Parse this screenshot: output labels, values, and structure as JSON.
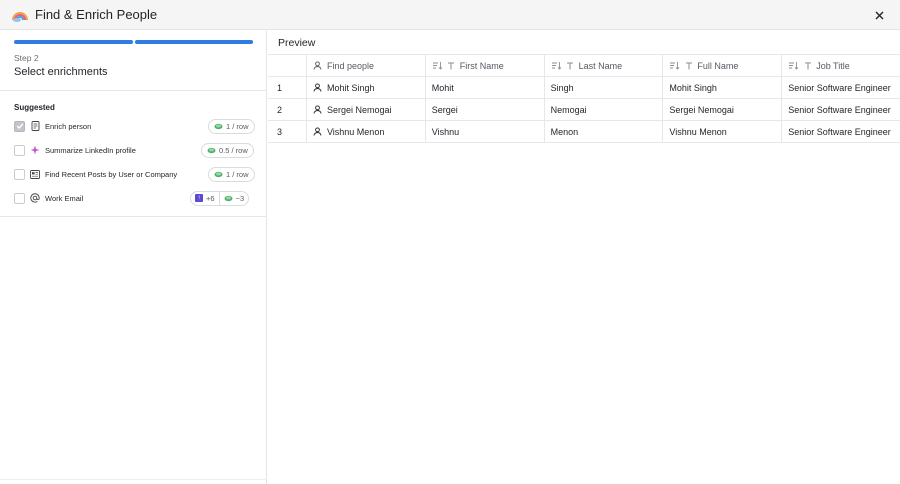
{
  "window": {
    "title": "Find & Enrich People",
    "logo_icon": "rainbow-cloud-icon",
    "close_icon": "close-icon"
  },
  "left_panel": {
    "progress": {
      "steps_total": 2,
      "steps_complete": 2,
      "accent": "#2f7de0"
    },
    "step_label": "Step 2",
    "step_title": "Select enrichments",
    "section_label": "Suggested",
    "enrichments": [
      {
        "label": "Enrich person",
        "checked": true,
        "icon": "document-icon",
        "cost": "1 / row"
      },
      {
        "label": "Summarize LinkedIn profile",
        "checked": false,
        "icon": "sparkle-icon",
        "cost": "0.5 / row"
      },
      {
        "label": "Find Recent Posts by User or Company",
        "checked": false,
        "icon": "newspaper-icon",
        "cost": "1 / row"
      },
      {
        "label": "Work Email",
        "checked": false,
        "icon": "at-sign-icon",
        "cost_extra": "+6",
        "cost": "~3"
      }
    ]
  },
  "preview": {
    "title": "Preview",
    "columns": [
      {
        "label": "Find people",
        "icon": "person-icon"
      },
      {
        "label": "First Name",
        "icon": "text-icon"
      },
      {
        "label": "Last Name",
        "icon": "text-icon"
      },
      {
        "label": "Full Name",
        "icon": "text-icon"
      },
      {
        "label": "Job Title",
        "icon": "text-icon"
      }
    ],
    "rows": [
      {
        "index": "1",
        "find_people": "Mohit Singh",
        "first_name": "Mohit",
        "last_name": "Singh",
        "full_name": "Mohit Singh",
        "job_title": "Senior Software Engineer"
      },
      {
        "index": "2",
        "find_people": "Sergei Nemogai",
        "first_name": "Sergei",
        "last_name": "Nemogai",
        "full_name": "Sergei Nemogai",
        "job_title": "Senior Software Engineer"
      },
      {
        "index": "3",
        "find_people": "Vishnu Menon",
        "first_name": "Vishnu",
        "last_name": "Menon",
        "full_name": "Vishnu Menon",
        "job_title": "Senior Software Engineer"
      }
    ]
  }
}
